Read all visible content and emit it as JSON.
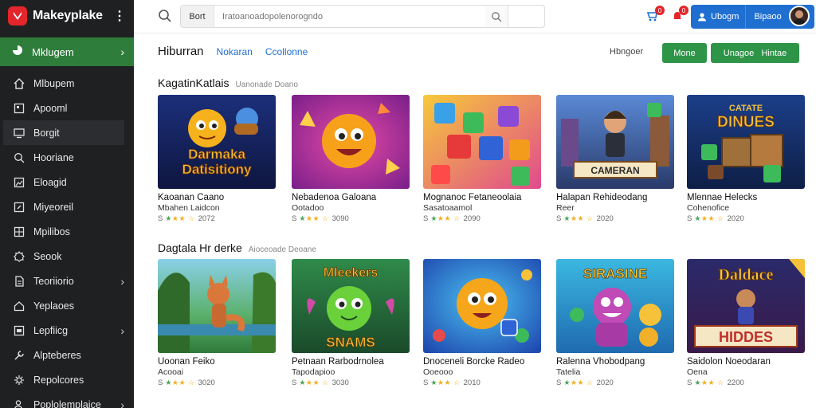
{
  "app": {
    "brand": "Makeyplake"
  },
  "sidebar": {
    "active": {
      "label": "Mklugem",
      "icon": "pinwheel-icon"
    },
    "items": [
      {
        "label": "Mlbupem",
        "icon": "home-icon",
        "chevron": false
      },
      {
        "label": "Apooml",
        "icon": "window-icon",
        "chevron": false
      },
      {
        "label": "Borgit",
        "icon": "monitor-icon",
        "chevron": false,
        "selected": true
      },
      {
        "label": "Hooriane",
        "icon": "search-icon",
        "chevron": false
      },
      {
        "label": "Eloagid",
        "icon": "image-icon",
        "chevron": false
      },
      {
        "label": "Miyeoreil",
        "icon": "edit-icon",
        "chevron": false
      },
      {
        "label": "Mpilibos",
        "icon": "grid-icon",
        "chevron": false
      },
      {
        "label": "Seook",
        "icon": "gear-icon",
        "chevron": false
      },
      {
        "label": "Teoriiorio",
        "icon": "document-icon",
        "chevron": true
      },
      {
        "label": "Yeplaoes",
        "icon": "house-icon",
        "chevron": false
      },
      {
        "label": "Lepfiicg",
        "icon": "layers-icon",
        "chevron": true
      },
      {
        "label": "Alpteberes",
        "icon": "wrench-icon",
        "chevron": false
      },
      {
        "label": "Repolcores",
        "icon": "gear-alt-icon",
        "chevron": false
      },
      {
        "label": "Poplolemplaice",
        "icon": "user-gear-icon",
        "chevron": true
      }
    ]
  },
  "topbar": {
    "search_scope": "Bort",
    "search_placeholder": "Iratoanoadopolenorogndo",
    "cart_badge": "0",
    "bell_badge": "0",
    "account_label": "Ubogm",
    "account_menu": "Bipaoo"
  },
  "header": {
    "title": "Hiburran",
    "tabs": [
      "Nokaran",
      "Ccollonne"
    ],
    "sort_label": "Hbngoer",
    "btn_primary": "Mone",
    "btn_secondary": "Unagoe   Hintae"
  },
  "sections": [
    {
      "title": "KagatinKatlais",
      "subtitle": "Uanonade  Doano",
      "cards": [
        {
          "title": "Kaoanan Caano",
          "subtitle": "Mbahen Laidcon",
          "rating_prefix": "S",
          "rating_value": "2072",
          "art": "dragon"
        },
        {
          "title": "Nebadenoa Galoana",
          "subtitle": "Ootadoo",
          "rating_prefix": "S",
          "rating_value": "3090",
          "art": "sun"
        },
        {
          "title": "Mognanoc Fetaneoolaia",
          "subtitle": "Sasatoaamol",
          "rating_prefix": "S",
          "rating_value": "2090",
          "art": "blocks"
        },
        {
          "title": "Halapan Rehideodang",
          "subtitle": "Reer",
          "rating_prefix": "S",
          "rating_value": "2020",
          "art": "hero"
        },
        {
          "title": "Mlennae Helecks",
          "subtitle": "Cohenofice",
          "rating_prefix": "S",
          "rating_value": "2020",
          "art": "dinoes"
        }
      ]
    },
    {
      "title": "Dagtala Hr derke",
      "subtitle": "Aioceoade  Deoane",
      "cards": [
        {
          "title": "Uoonan Feiko",
          "subtitle": "Acooai",
          "rating_prefix": "S",
          "rating_value": "3020",
          "art": "fox"
        },
        {
          "title": "Petnaan Rarbodrnolea",
          "subtitle": "Tapodapioo",
          "rating_prefix": "S",
          "rating_value": "3030",
          "art": "snams"
        },
        {
          "title": "Dnoceneli Borcke Radeo",
          "subtitle": "Ooeooo",
          "rating_prefix": "S",
          "rating_value": "2010",
          "art": "bubble"
        },
        {
          "title": "Ralenna Vhobodpang",
          "subtitle": "Tatelia",
          "rating_prefix": "S",
          "rating_value": "2020",
          "art": "sirasine"
        },
        {
          "title": "Saidolon Noeodaran",
          "subtitle": "Oena",
          "rating_prefix": "S",
          "rating_value": "2200",
          "art": "hiddes"
        }
      ]
    }
  ],
  "art_text": {
    "dragon": "Darmaka Datisitiony",
    "blocks_banner": "CAMERAN",
    "dinoes_top": "CATATE",
    "dinoes_main": "DINUES",
    "snams_top": "Mleekers",
    "snams_bottom": "SNAMS",
    "sirasine": "SIRASINE",
    "hiddes_top": "Daldace",
    "hiddes_bottom": "HIDDES"
  },
  "colors": {
    "sidebar_bg": "#1f2022",
    "active_green": "#2e7d3a",
    "accent_blue": "#1f6fd1",
    "button_green": "#2e9447",
    "brand_red": "#e3262b"
  }
}
